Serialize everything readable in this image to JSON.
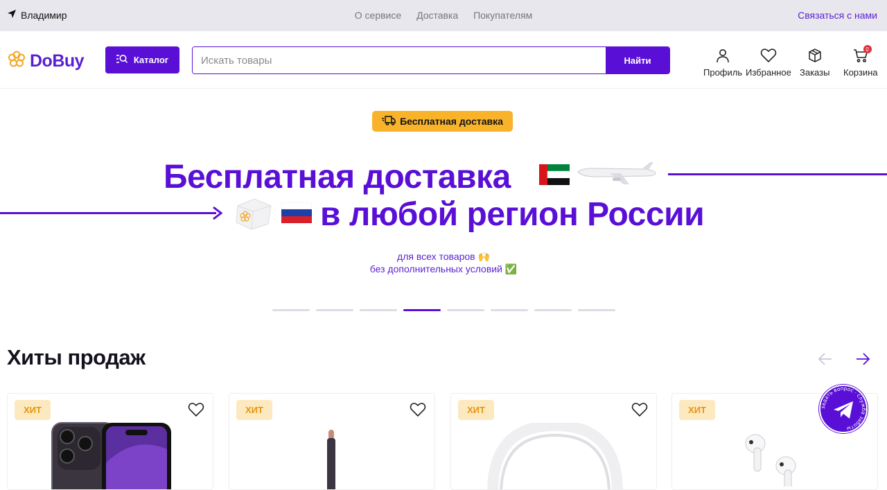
{
  "topbar": {
    "city": "Владимир",
    "nav": [
      "О сервисе",
      "Доставка",
      "Покупателям"
    ],
    "contact": "Связаться с нами"
  },
  "header": {
    "logo": "DoBuy",
    "catalog_label": "Каталог",
    "search_placeholder": "Искать товары",
    "search_button": "Найти",
    "profile": "Профиль",
    "favorites": "Избранное",
    "orders": "Заказы",
    "cart": "Корзина",
    "cart_count": "0"
  },
  "banner": {
    "pill": "Бесплатная доставка",
    "line1": "Бесплатная доставка",
    "line2": "в любой регион России",
    "sub1": "для всех товаров 🙌",
    "sub2": "без дополнительных условий ✅",
    "slides_total": 8,
    "active_slide": 4
  },
  "hits": {
    "title": "Хиты продаж",
    "badge": "ХИТ"
  },
  "help_widget": {
    "text": "задать вопрос · служба заботы"
  },
  "colors": {
    "accent": "#5a0fd6",
    "badge_bg": "#fde9bf",
    "badge_text": "#e5950f",
    "pill": "#f9b32a"
  }
}
